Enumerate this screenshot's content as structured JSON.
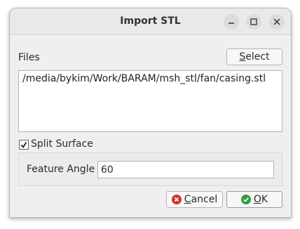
{
  "window": {
    "title": "Import STL",
    "controls": {
      "minimize": "minimize-icon",
      "maximize": "maximize-icon",
      "close": "close-icon"
    }
  },
  "files": {
    "label": "Files",
    "select_prefix": "S",
    "select_rest": "elect",
    "path": "/media/bykim/Work/BARAM/msh_stl/fan/casing.stl"
  },
  "split_surface": {
    "label": "Split Surface",
    "checked": true
  },
  "feature_angle": {
    "label": "Feature Angle",
    "value": "60"
  },
  "buttons": {
    "cancel_prefix": "C",
    "cancel_rest": "ancel",
    "ok_prefix": "O",
    "ok_rest": "K",
    "cancel_icon": "cancel-icon",
    "ok_icon": "ok-icon"
  },
  "colors": {
    "cancel_icon": "#d2342f",
    "ok_icon": "#2e9c3f"
  }
}
